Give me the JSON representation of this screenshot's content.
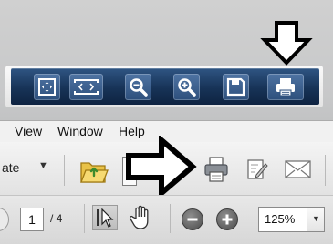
{
  "floating_toolbar": {
    "buttons": [
      {
        "icon": "fit-page-icon"
      },
      {
        "icon": "fit-width-icon"
      },
      {
        "icon": "zoom-out-icon"
      },
      {
        "icon": "zoom-in-icon"
      },
      {
        "icon": "save-icon"
      },
      {
        "icon": "print-icon"
      }
    ]
  },
  "menu": {
    "items": [
      "View",
      "Window",
      "Help"
    ]
  },
  "toolbar": {
    "create_label": "ate",
    "create_caret": "▼",
    "icons": [
      "open-folder-icon",
      "print-icon",
      "edit-icon",
      "email-icon"
    ]
  },
  "nav": {
    "page_current": "1",
    "page_total": "/ 4",
    "zoom_value": "125%",
    "zoom_caret": "▼"
  },
  "colors": {
    "float_bar": "#173357",
    "float_button": "#3f6290",
    "arrow_fill": "#ffffff",
    "arrow_stroke": "#000000"
  }
}
